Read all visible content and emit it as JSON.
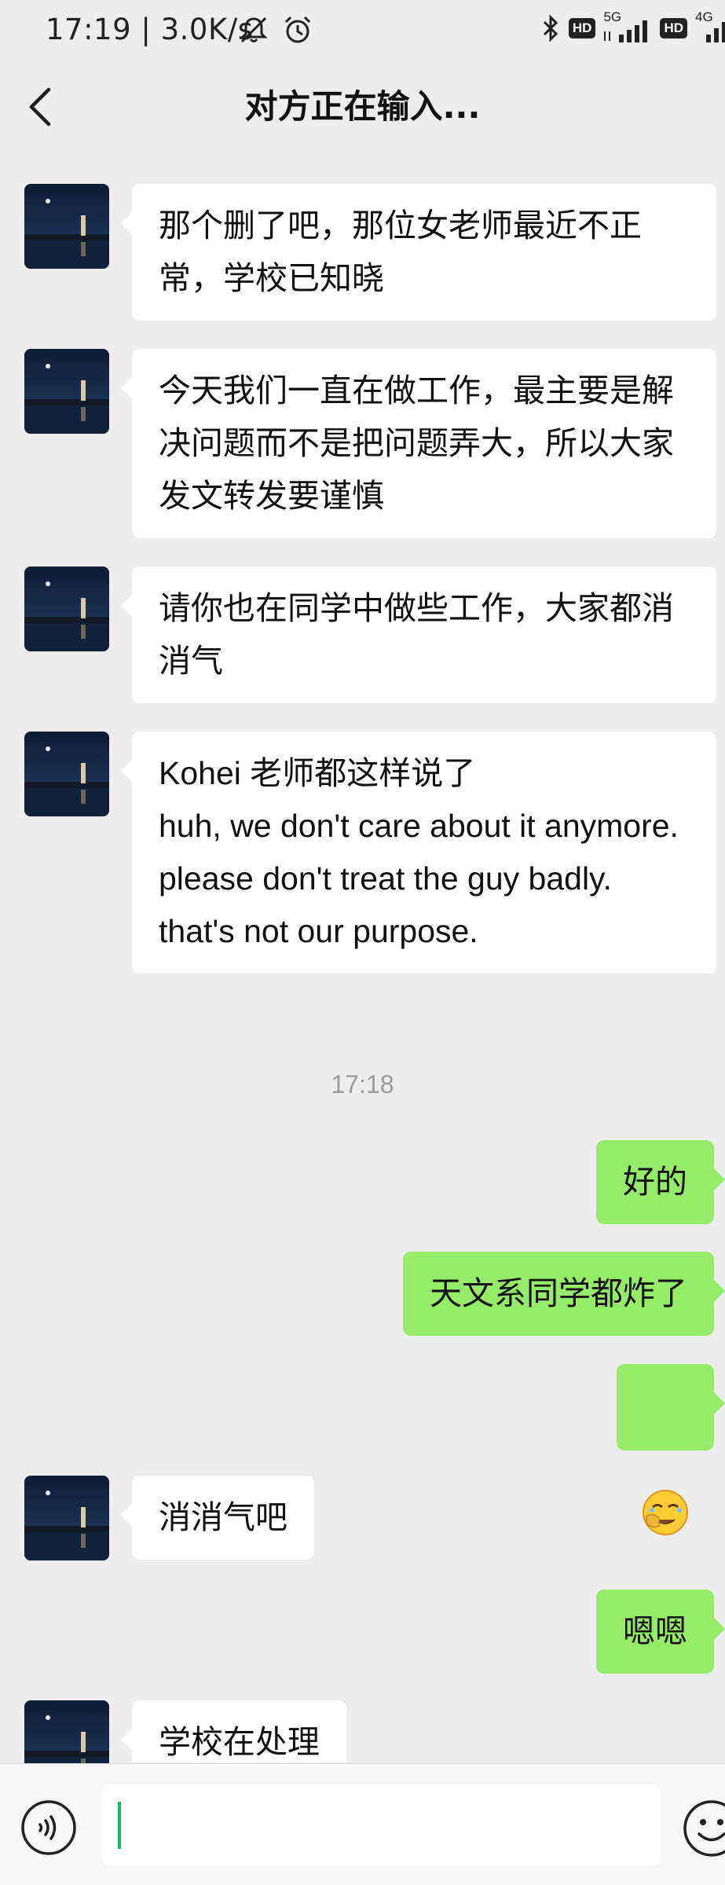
{
  "status_bar": {
    "time_speed": "17:19 | 3.0K/s",
    "hd_label": "HD",
    "net_5g": "5G",
    "net_4g": "4G"
  },
  "header": {
    "title": "对方正在输入..."
  },
  "messages": [
    {
      "side": "in",
      "text": "那个删了吧，那位女老师最近不正常，学校已知晓"
    },
    {
      "side": "in",
      "text": "今天我们一直在做工作，最主要是解决问题而不是把问题弄大，所以大家发文转发要谨慎"
    },
    {
      "side": "in",
      "text": "请你也在同学中做些工作，大家都消消气"
    },
    {
      "side": "in",
      "text": "Kohei 老师都这样说了\nhuh, we don't care about it anymore. please don't treat the guy badly. that's not our purpose."
    },
    {
      "side": "out",
      "text": "好的"
    },
    {
      "side": "out",
      "text": "天文系同学都炸了"
    },
    {
      "side": "out",
      "emoji": "facepalm-emoji"
    },
    {
      "side": "in",
      "text": "消消气吧"
    },
    {
      "side": "out",
      "text": "嗯嗯"
    },
    {
      "side": "in",
      "text": "学校在处理"
    }
  ],
  "timestamp": "17:18",
  "input_bar": {
    "value": "",
    "placeholder": ""
  },
  "icons": {
    "back": "chevron-left-icon",
    "voice": "voice-icon",
    "emoji": "emoji-icon",
    "avatar": "night-lake-avatar"
  },
  "colors": {
    "background": "#ededed",
    "incoming_bubble": "#ffffff",
    "outgoing_bubble": "#95ec69",
    "caret": "#07c160"
  }
}
